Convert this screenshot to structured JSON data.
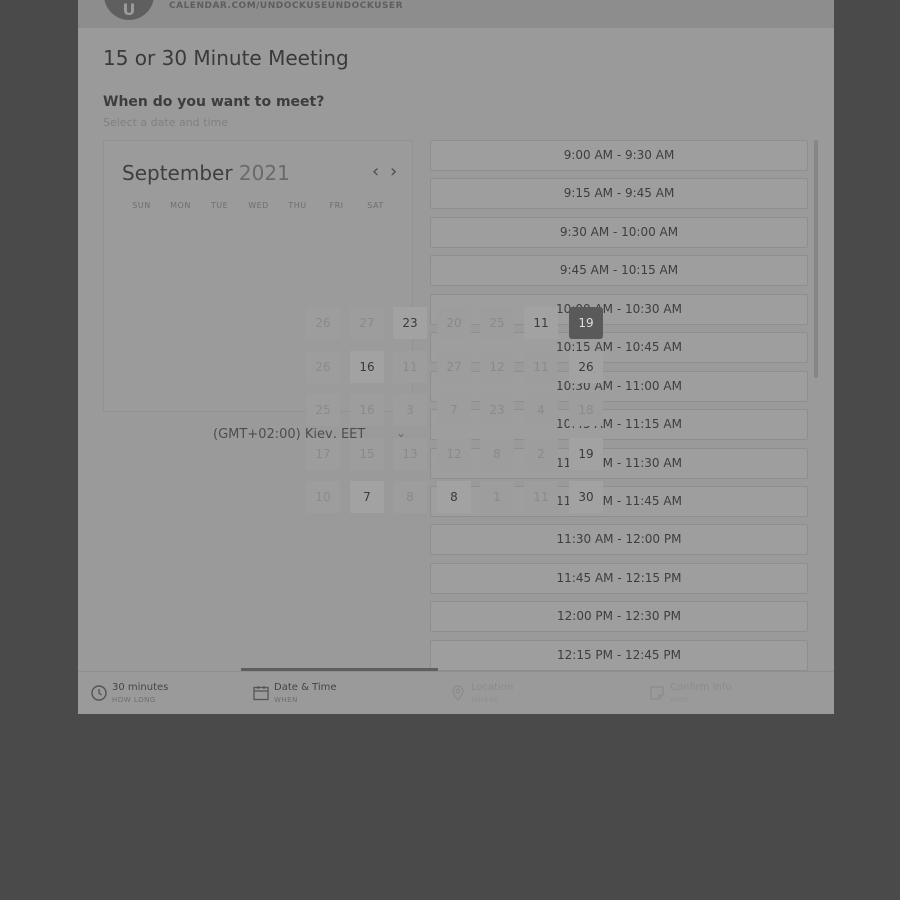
{
  "header": {
    "avatar_initials": "U",
    "calendar_url": "CALENDAR.COM/UNDOCKUSEUNDOCKUSER"
  },
  "event": {
    "title": "15 or 30 Minute Meeting",
    "question": "When do you want to meet?",
    "subtitle": "Select a date and time"
  },
  "calendar": {
    "month": "September",
    "year": "2021",
    "weekdays": [
      "SUN",
      "MON",
      "TUE",
      "WED",
      "THU",
      "FRI",
      "SAT"
    ],
    "selected_day": "19",
    "visible_day_labels": [
      "26",
      "27",
      "23",
      "20",
      "25",
      "11",
      "19",
      "26",
      "16",
      "11",
      "27",
      "12",
      "11",
      "26",
      "25",
      "16",
      "3",
      "7",
      "23",
      "4",
      "18",
      "17",
      "15",
      "13",
      "12",
      "8",
      "2",
      "19",
      "10",
      "7",
      "8",
      "8",
      "1",
      "11",
      "30"
    ]
  },
  "timezone": {
    "label": "(GMT+02:00) Kiev, EET"
  },
  "time_slots": [
    "9:00 AM - 9:30 AM",
    "9:15 AM - 9:45 AM",
    "9:30 AM - 10:00 AM",
    "9:45 AM - 10:15 AM",
    "10:00 AM - 10:30 AM",
    "10:15 AM - 10:45 AM",
    "10:30 AM - 11:00 AM",
    "10:45 AM - 11:15 AM",
    "11:00 AM - 11:30 AM",
    "11:15 AM - 11:45 AM",
    "11:30 AM - 12:00 PM",
    "11:45 AM - 12:15 PM",
    "12:00 PM - 12:30 PM",
    "12:15 PM - 12:45 PM"
  ],
  "steps": [
    {
      "title": "30 minutes",
      "sub": "HOW LONG",
      "icon": "clock-icon"
    },
    {
      "title": "Date & Time",
      "sub": "WHEN",
      "icon": "calendar-icon"
    },
    {
      "title": "Location",
      "sub": "WHERE",
      "icon": "location-pin-icon"
    },
    {
      "title": "Confirm Info",
      "sub": "WHO",
      "icon": "note-icon"
    }
  ],
  "colors": {
    "backdrop": "#4a4a4a",
    "panel": "#9a9a9a",
    "selected_day": "#5a5a5a"
  }
}
